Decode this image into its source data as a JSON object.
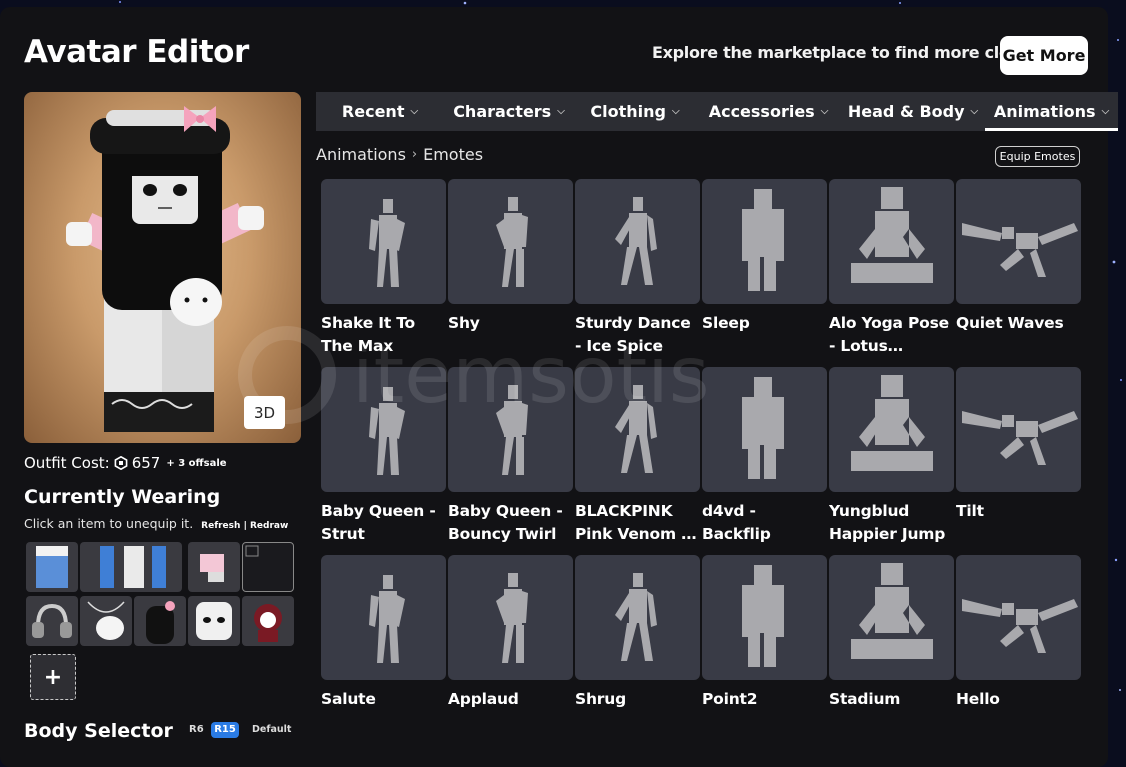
{
  "page": {
    "title": "Avatar Editor"
  },
  "header": {
    "explore_text": "Explore the marketplace to find more clothes!",
    "get_more_label": "Get More"
  },
  "preview": {
    "toggle_label": "3D"
  },
  "outfit": {
    "cost_label": "Outfit Cost:",
    "cost_value": "657",
    "offsale_note": "+ 3 offsale"
  },
  "currently_wearing": {
    "title": "Currently Wearing",
    "subtitle": "Click an item to unequip it.",
    "refresh_link": "Refresh",
    "separator": "|",
    "redraw_link": "Redraw",
    "add_label": "+"
  },
  "body_selector": {
    "title": "Body Selector",
    "options": [
      "R6",
      "R15",
      "Default"
    ],
    "selected": "R15"
  },
  "tabs": [
    {
      "label": "Recent",
      "active": false
    },
    {
      "label": "Characters",
      "active": false
    },
    {
      "label": "Clothing",
      "active": false
    },
    {
      "label": "Accessories",
      "active": false
    },
    {
      "label": "Head & Body",
      "active": false
    },
    {
      "label": "Animations",
      "active": true
    }
  ],
  "breadcrumb": {
    "parent": "Animations",
    "current": "Emotes"
  },
  "equip_button": "Equip Emotes",
  "items": [
    {
      "name": "Shake It To The Max"
    },
    {
      "name": "Shy"
    },
    {
      "name": "Sturdy Dance - Ice Spice"
    },
    {
      "name": "Sleep"
    },
    {
      "name": "Alo Yoga Pose - Lotus Position"
    },
    {
      "name": "Quiet Waves"
    },
    {
      "name": "Baby Queen - Strut"
    },
    {
      "name": "Baby Queen - Bouncy Twirl"
    },
    {
      "name": "BLACKPINK Pink Venom - Straig..."
    },
    {
      "name": "d4vd - Backflip"
    },
    {
      "name": "Yungblud Happier Jump"
    },
    {
      "name": "Tilt"
    },
    {
      "name": "Salute"
    },
    {
      "name": "Applaud"
    },
    {
      "name": "Shrug"
    },
    {
      "name": "Point2"
    },
    {
      "name": "Stadium"
    },
    {
      "name": "Hello"
    }
  ],
  "colors": {
    "panel": "#121215",
    "tab_bar": "#2c2d33",
    "thumb": "#393b46",
    "accent": "#2a7be4"
  },
  "watermark": "itemsotis"
}
